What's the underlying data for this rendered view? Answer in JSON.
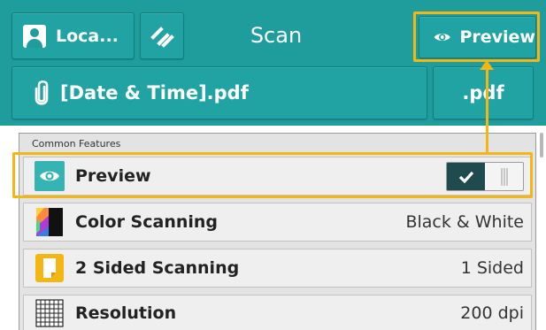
{
  "header": {
    "user_label": "Loca...",
    "title": "Scan",
    "preview_label": "Preview",
    "filename": "[Date & Time].pdf",
    "extension": ".pdf"
  },
  "section": {
    "label": "Common Features"
  },
  "rows": [
    {
      "label": "Preview",
      "value": "",
      "toggle_on": true
    },
    {
      "label": "Color Scanning",
      "value": "Black & White"
    },
    {
      "label": "2 Sided Scanning",
      "value": "1 Sided"
    },
    {
      "label": "Resolution",
      "value": "200 dpi"
    }
  ],
  "colors": {
    "header_teal": "#1f9c9c",
    "highlight": "#f4b614",
    "toggle_dark": "#1f4a4e"
  },
  "icons": [
    "user-icon",
    "reset-icon",
    "eye-icon",
    "paperclip-icon",
    "color-icon",
    "sided-icon",
    "grid-icon",
    "checkmark-icon"
  ]
}
